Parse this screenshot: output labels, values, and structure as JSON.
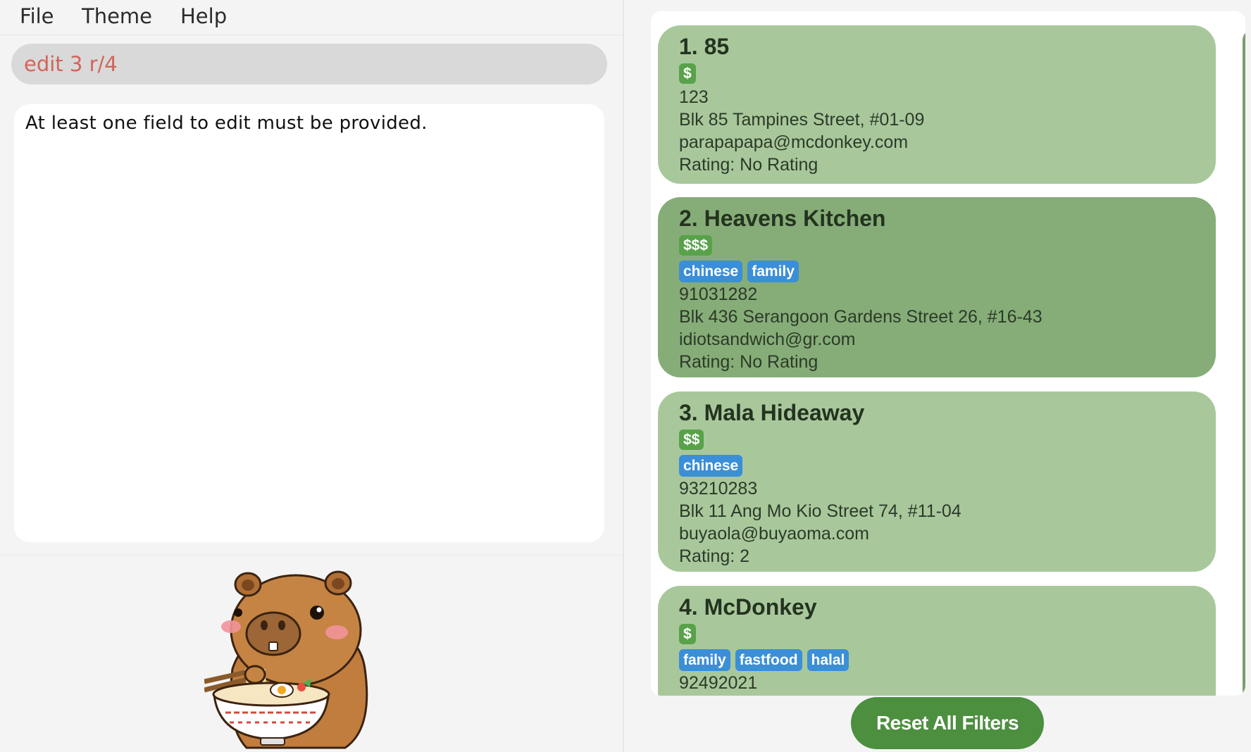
{
  "menu": {
    "file": "File",
    "theme": "Theme",
    "help": "Help"
  },
  "command": {
    "value": "edit 3 r/4"
  },
  "result": {
    "message": "At least one field to edit must be provided."
  },
  "restaurants": [
    {
      "title": "1. 85",
      "price": "$",
      "tags": [],
      "phone": "123",
      "address": "Blk 85 Tampines Street, #01-09",
      "email": "parapapapa@mcdonkey.com",
      "rating": "Rating: No Rating"
    },
    {
      "title": "2. Heavens Kitchen",
      "price": "$$$",
      "tags": [
        "chinese",
        "family"
      ],
      "phone": "91031282",
      "address": "Blk 436 Serangoon Gardens Street 26, #16-43",
      "email": "idiotsandwich@gr.com",
      "rating": "Rating: No Rating"
    },
    {
      "title": "3. Mala Hideaway",
      "price": "$$",
      "tags": [
        "chinese"
      ],
      "phone": "93210283",
      "address": "Blk 11 Ang Mo Kio Street 74, #11-04",
      "email": "buyaola@buyaoma.com",
      "rating": "Rating: 2"
    },
    {
      "title": "4. McDonkey",
      "price": "$",
      "tags": [
        "family",
        "fastfood",
        "halal"
      ],
      "phone": "92492021"
    }
  ],
  "reset_button": "Reset All Filters",
  "colors": {
    "card": "#a8c89c",
    "card_selected": "#86ad78",
    "price_badge": "#58a24a",
    "tag_badge": "#3b8ed8",
    "button": "#4c8f3f",
    "command_text": "#d2645a"
  }
}
